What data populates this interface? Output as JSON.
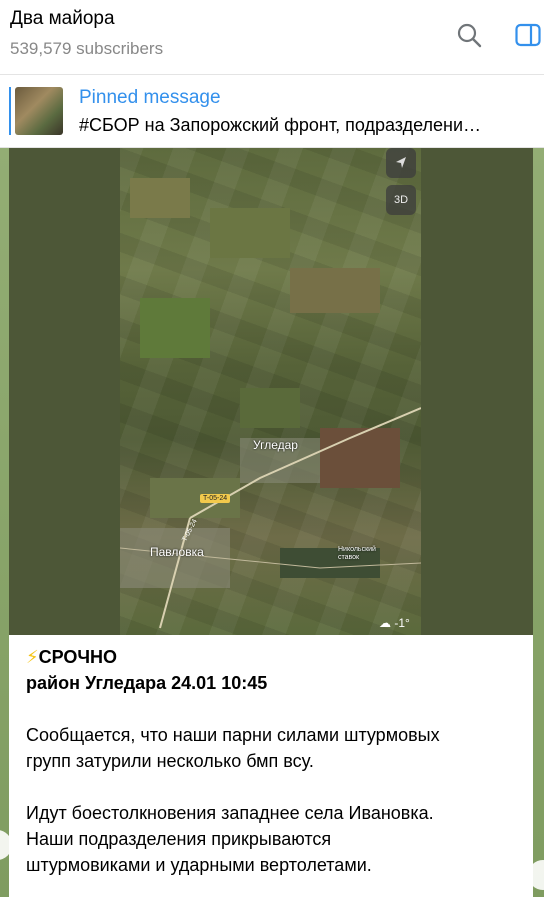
{
  "header": {
    "channel_name": "Два майора",
    "subscribers": "539,579 subscribers",
    "search_icon": "search-icon",
    "sidebar_icon": "sidebar-toggle-icon"
  },
  "pinned": {
    "label": "Pinned message",
    "text": "#СБОР на Запорожский фронт, подразделени…"
  },
  "map": {
    "labels": {
      "ugledar": "Угледар",
      "pavlovka": "Павловка",
      "reservoir": "Никольский ставок",
      "road1": "T-05-24",
      "road2": "T-05-24"
    },
    "btn_3d": "3D",
    "weather": "-1°"
  },
  "post": {
    "urgent": "СРОЧНО",
    "subtitle": "район Угледара 24.01 10:45",
    "para1_line1": "Сообщается, что наши парни силами штурмовых",
    "para1_line2": "групп затурили несколько бмп всу.",
    "para2_line1": "Идут боестолкновения западнее села Ивановка.",
    "para2_line2": "Наши подразделения прикрываются",
    "para2_line3": "штурмовиками и ударными вертолетами."
  },
  "colors": {
    "accent": "#3390ec",
    "lightning": "#f5c518"
  }
}
